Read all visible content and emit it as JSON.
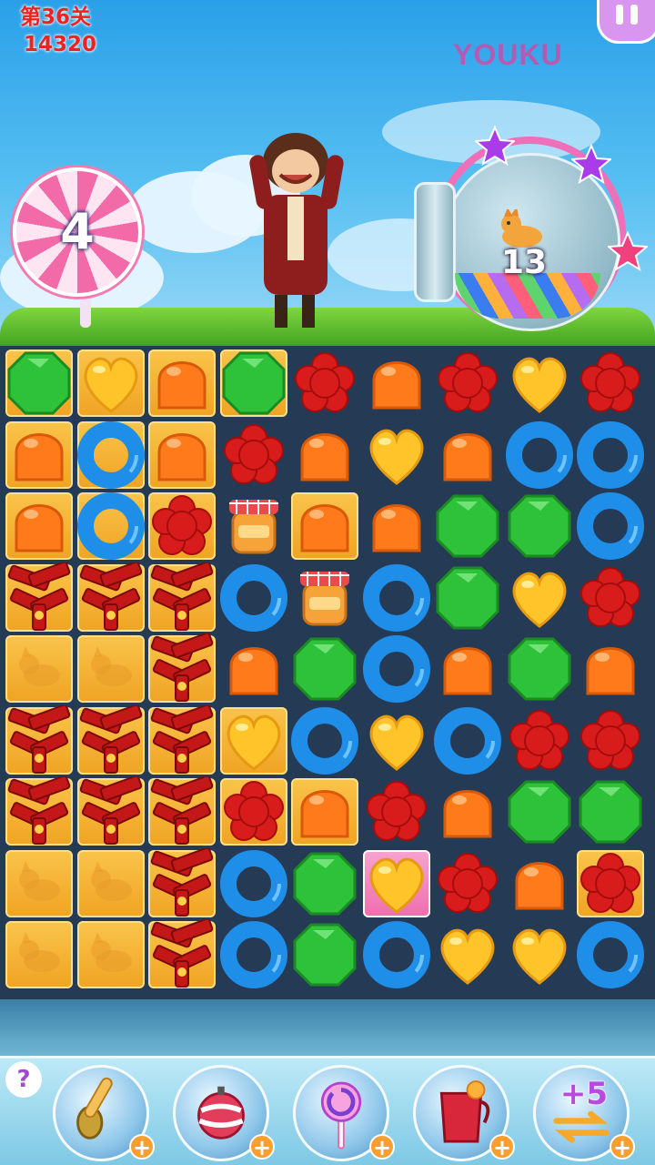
{
  "hud": {
    "level_label": "第36关",
    "score": "14320",
    "moves_left": "4",
    "watermark": "YOUKU"
  },
  "goal": {
    "target_icon": "puppy-icon",
    "remaining": "13",
    "stars_earned": 3
  },
  "colors": {
    "red_text": "#e22222",
    "tile_gold": "#f0a424",
    "star_purple": "#a93ce8",
    "star_pink": "#f0407e",
    "booster_plus": "#ff9d2f"
  },
  "board": {
    "columns": 9,
    "rows": 9,
    "piece_types": {
      "G": "green-octagon-candy",
      "Y": "yellow-heart-candy",
      "O": "orange-gumdrop-candy",
      "R": "red-flower-candy",
      "B": "blue-ring-candy",
      "J": "jam-jar",
      "F": "firecracker-bundle",
      "P": "puppy-tile"
    },
    "grid": [
      [
        "G",
        "Y",
        "O",
        "G",
        "R",
        "O",
        "R",
        "Y",
        "R"
      ],
      [
        "O",
        "B",
        "O",
        "R",
        "O",
        "Y",
        "O",
        "B",
        "B"
      ],
      [
        "O",
        "B",
        "R",
        "J",
        "O",
        "O",
        "G",
        "G",
        "B"
      ],
      [
        "F",
        "F",
        "F",
        "B",
        "J",
        "B",
        "G",
        "Y",
        "R"
      ],
      [
        "P",
        "P",
        "F",
        "O",
        "G",
        "B",
        "O",
        "G",
        "O"
      ],
      [
        "F",
        "F",
        "F",
        "Y",
        "B",
        "Y",
        "B",
        "R",
        "R"
      ],
      [
        "F",
        "F",
        "F",
        "R",
        "O",
        "R",
        "O",
        "G",
        "G"
      ],
      [
        "P",
        "P",
        "F",
        "B",
        "G",
        "Y",
        "R",
        "O",
        "R"
      ],
      [
        "P",
        "P",
        "F",
        "B",
        "G",
        "B",
        "Y",
        "Y",
        "B"
      ]
    ],
    "gold_tiles": [
      [
        1,
        1,
        1,
        1,
        0,
        0,
        0,
        0,
        0
      ],
      [
        1,
        1,
        1,
        0,
        0,
        0,
        0,
        0,
        0
      ],
      [
        1,
        1,
        1,
        0,
        1,
        0,
        0,
        0,
        0
      ],
      [
        1,
        1,
        1,
        0,
        0,
        0,
        0,
        0,
        0
      ],
      [
        1,
        1,
        1,
        0,
        0,
        0,
        0,
        0,
        0
      ],
      [
        1,
        1,
        1,
        1,
        0,
        0,
        0,
        0,
        0
      ],
      [
        1,
        1,
        1,
        1,
        1,
        0,
        0,
        0,
        0
      ],
      [
        1,
        1,
        1,
        0,
        0,
        2,
        0,
        0,
        1
      ],
      [
        1,
        1,
        1,
        0,
        0,
        0,
        0,
        0,
        0
      ]
    ]
  },
  "boosters": [
    {
      "name": "spoon-booster",
      "icon": "spoon-icon"
    },
    {
      "name": "bomb-booster",
      "icon": "candy-bomb-icon"
    },
    {
      "name": "lollipop-booster",
      "icon": "lollipop-icon"
    },
    {
      "name": "juice-booster",
      "icon": "juice-jug-icon"
    },
    {
      "name": "extra-moves-booster",
      "icon": "swap-arrows-icon",
      "label": "+5"
    }
  ],
  "help_label": "?",
  "plus_label": "+"
}
